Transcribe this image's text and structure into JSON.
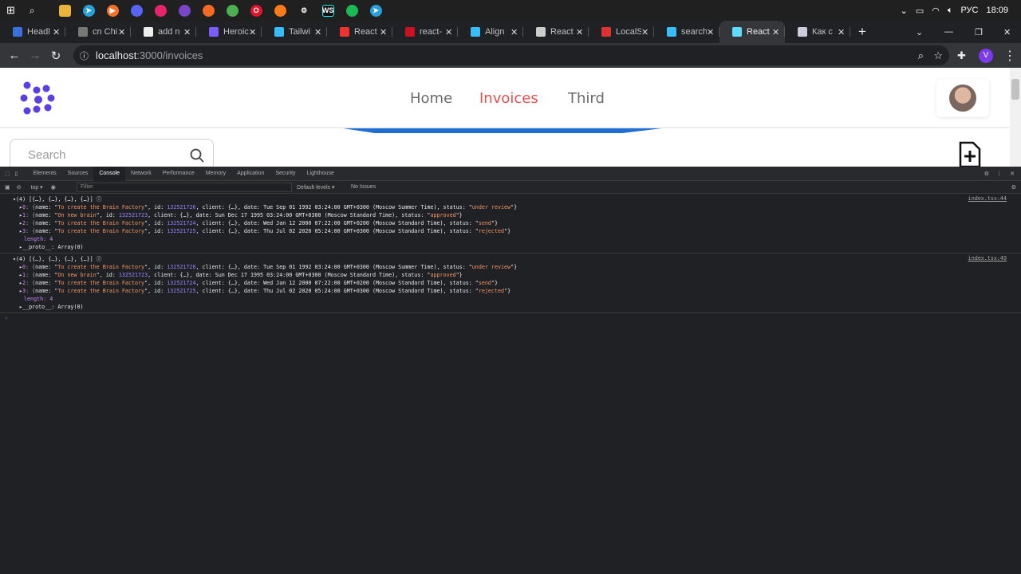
{
  "taskbar": {
    "lang": "РУС",
    "time": "18:09"
  },
  "tabs": [
    {
      "title": "Headl",
      "color": "#3b6fd9"
    },
    {
      "title": "cn Chi",
      "color": "#777"
    },
    {
      "title": "add n",
      "color": "#eee"
    },
    {
      "title": "Heroic",
      "color": "#7c5cff"
    },
    {
      "title": "Tailwi",
      "color": "#38bdf8"
    },
    {
      "title": "React",
      "color": "#e33"
    },
    {
      "title": "react-",
      "color": "#c12"
    },
    {
      "title": "Align",
      "color": "#38bdf8"
    },
    {
      "title": "React",
      "color": "#ccc"
    },
    {
      "title": "LocalS",
      "color": "#d33"
    },
    {
      "title": "search",
      "color": "#38bdf8"
    },
    {
      "title": "React",
      "color": "#61dafb"
    },
    {
      "title": "Как с",
      "color": "#ccd"
    }
  ],
  "address": {
    "host": "localhost",
    "path": ":3000/invoices",
    "profile": "V"
  },
  "nav": {
    "home": "Home",
    "invoices": "Invoices",
    "third": "Third"
  },
  "search": {
    "placeholder": "Search"
  },
  "devtools": {
    "tabs": [
      "Elements",
      "Sources",
      "Console",
      "Network",
      "Performance",
      "Memory",
      "Application",
      "Security",
      "Lighthouse"
    ],
    "context": "top ▾",
    "filter": "Filter",
    "levels": "Default levels ▾",
    "issues": "No Issues"
  },
  "console": [
    {
      "source": "index.tsx:44",
      "header": "▾(4) [{…}, {…}, {…}, {…}] ⓘ",
      "items": [
        {
          "i": "0",
          "name": "To create the Brain Factory",
          "id": "132521726",
          "date": "Tue Sep 01 1992 03:24:00 GMT+0300 (Moscow Summer Time)",
          "status": "under review"
        },
        {
          "i": "1",
          "name": "On new brain",
          "id": "132521723",
          "date": "Sun Dec 17 1995 03:24:00 GMT+0300 (Moscow Standard Time)",
          "status": "approved"
        },
        {
          "i": "2",
          "name": "To create the Brain Factory",
          "id": "132521724",
          "date": "Wed Jan 12 2000 07:22:00 GMT+0200 (Moscow Standard Time)",
          "status": "send"
        },
        {
          "i": "3",
          "name": "To create the Brain Factory",
          "id": "132521725",
          "date": "Thu Jul 02 2020 05:24:00 GMT+0300 (Moscow Standard Time)",
          "status": "rejected"
        }
      ],
      "length": "length: 4",
      "proto": "▸__proto__: Array(0)"
    },
    {
      "source": "index.tsx:49",
      "header": "▾(4) [{…}, {…}, {…}, {…}] ⓘ",
      "items": [
        {
          "i": "0",
          "name": "To create the Brain Factory",
          "id": "132521726",
          "date": "Tue Sep 01 1992 03:24:00 GMT+0300 (Moscow Summer Time)",
          "status": "under review"
        },
        {
          "i": "1",
          "name": "On new brain",
          "id": "132521723",
          "date": "Sun Dec 17 1995 03:24:00 GMT+0300 (Moscow Standard Time)",
          "status": "approved"
        },
        {
          "i": "2",
          "name": "To create the Brain Factory",
          "id": "132521724",
          "date": "Wed Jan 12 2000 07:22:00 GMT+0200 (Moscow Standard Time)",
          "status": "send"
        },
        {
          "i": "3",
          "name": "To create the Brain Factory",
          "id": "132521725",
          "date": "Thu Jul 02 2020 05:24:00 GMT+0300 (Moscow Standard Time)",
          "status": "rejected"
        }
      ],
      "length": "length: 4",
      "proto": "▸__proto__: Array(0)"
    }
  ]
}
